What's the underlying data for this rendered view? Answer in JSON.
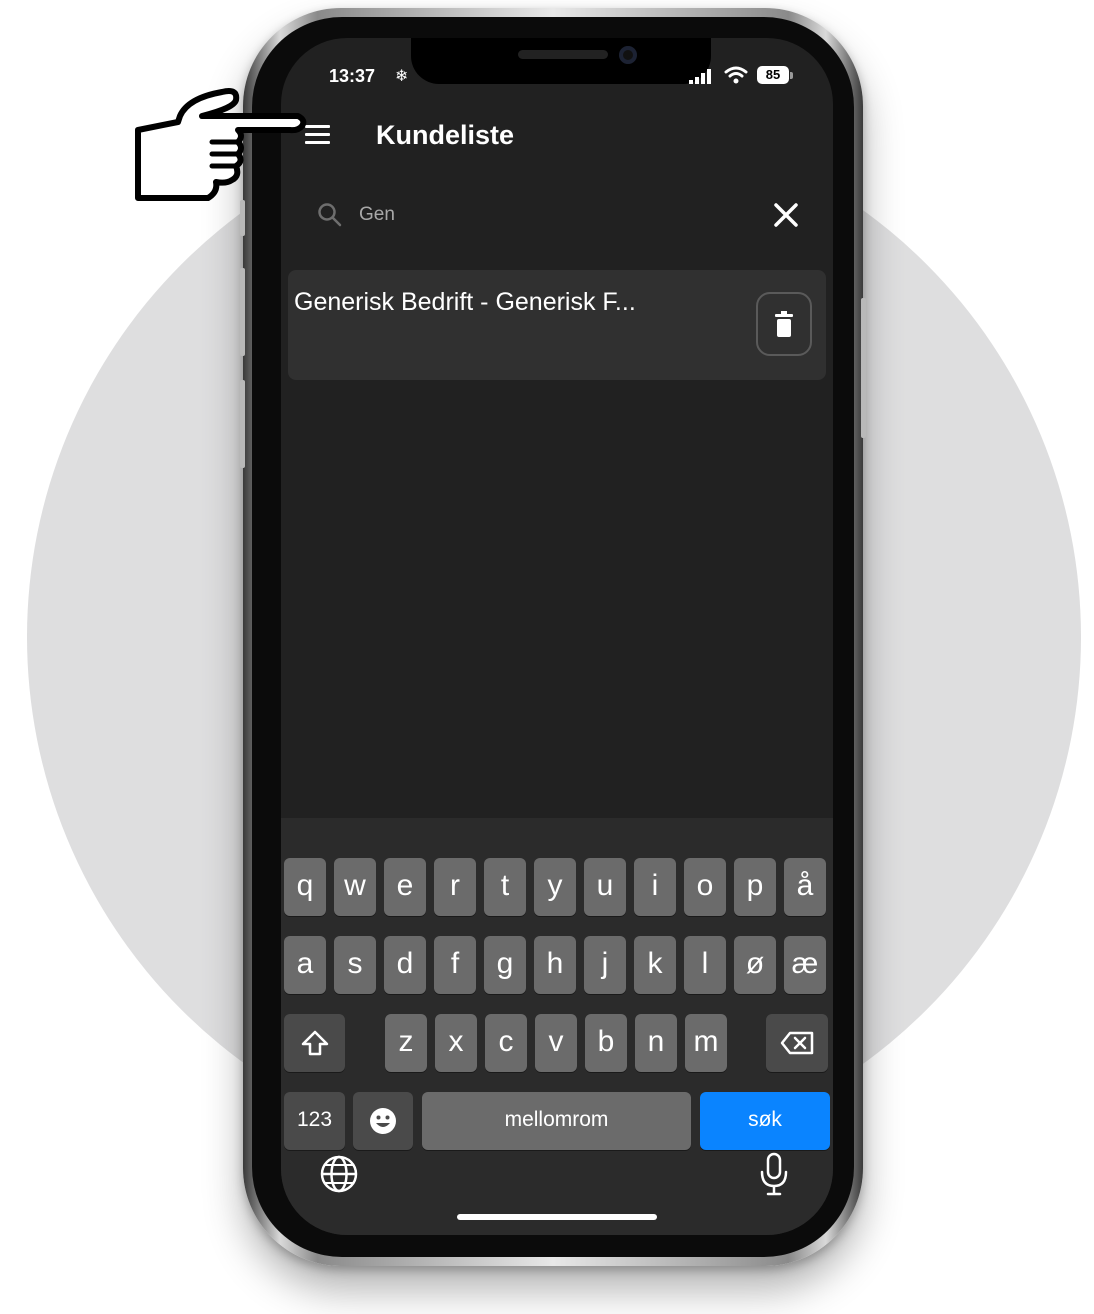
{
  "status_bar": {
    "time": "13:37",
    "battery": "85"
  },
  "header": {
    "title": "Kundeliste"
  },
  "search": {
    "value": "Gen"
  },
  "results": [
    {
      "label": "Generisk Bedrift - Generisk F..."
    }
  ],
  "keyboard": {
    "row1": [
      "q",
      "w",
      "e",
      "r",
      "t",
      "y",
      "u",
      "i",
      "o",
      "p",
      "å"
    ],
    "row2": [
      "a",
      "s",
      "d",
      "f",
      "g",
      "h",
      "j",
      "k",
      "l",
      "ø",
      "æ"
    ],
    "row3": [
      "z",
      "x",
      "c",
      "v",
      "b",
      "n",
      "m"
    ],
    "numbers_label": "123",
    "space_label": "mellomrom",
    "action_label": "søk"
  },
  "colors": {
    "accent": "#0a84ff",
    "screen_bg": "#212121",
    "card_bg": "#303030"
  }
}
